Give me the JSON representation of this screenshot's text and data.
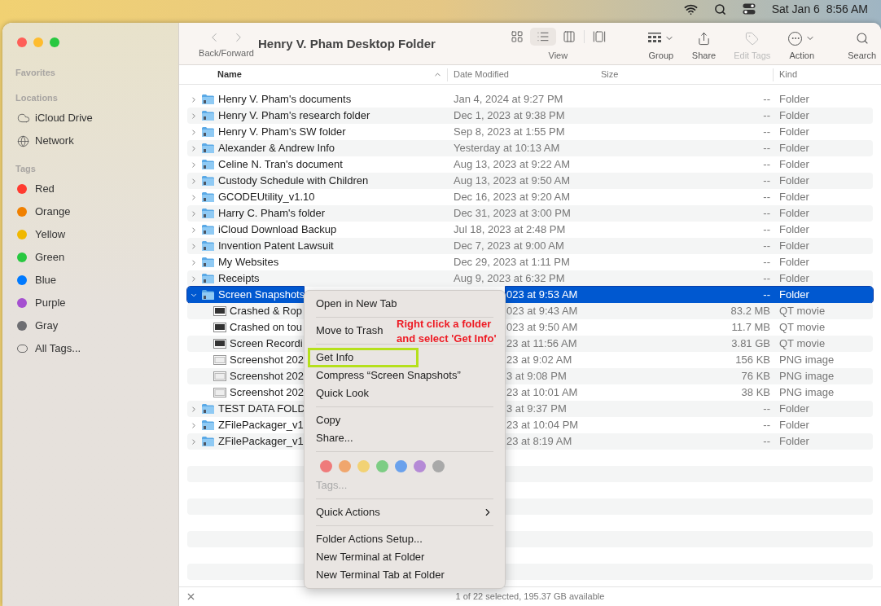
{
  "menu_bar": {
    "clock": "Sat Jan 6  8:56 AM"
  },
  "sidebar": {
    "sections": [
      {
        "title": "Favorites"
      },
      {
        "title": "Locations",
        "items": [
          {
            "label": "iCloud Drive",
            "kind": "cloud"
          },
          {
            "label": "Network",
            "kind": "network"
          }
        ]
      },
      {
        "title": "Tags",
        "items": [
          {
            "label": "Red",
            "kind": "tag",
            "color": "#ff3b30"
          },
          {
            "label": "Orange",
            "kind": "tag",
            "color": "#f08000"
          },
          {
            "label": "Yellow",
            "kind": "tag",
            "color": "#f0b800"
          },
          {
            "label": "Green",
            "kind": "tag",
            "color": "#28c840"
          },
          {
            "label": "Blue",
            "kind": "tag",
            "color": "#007aff"
          },
          {
            "label": "Purple",
            "kind": "tag",
            "color": "#a550d0"
          },
          {
            "label": "Gray",
            "kind": "tag",
            "color": "#6e6e72"
          },
          {
            "label": "All Tags...",
            "kind": "alltags"
          }
        ]
      }
    ]
  },
  "toolbar": {
    "nav_label": "Back/Forward",
    "title": "Henry V. Pham Desktop Folder",
    "view": {
      "label": "View",
      "modes": [
        {
          "kind": "icons",
          "selected": false
        },
        {
          "kind": "list",
          "selected": true
        },
        {
          "kind": "columns",
          "selected": false
        },
        {
          "kind": "gallery",
          "selected": false
        }
      ]
    },
    "buttons": [
      {
        "kind": "group",
        "label": "Group",
        "disabled": false
      },
      {
        "kind": "share",
        "label": "Share",
        "disabled": false
      },
      {
        "kind": "tags",
        "label": "Edit Tags",
        "disabled": true
      },
      {
        "kind": "action",
        "label": "Action",
        "disabled": false
      },
      {
        "kind": "search",
        "label": "Search",
        "disabled": false
      }
    ]
  },
  "table": {
    "columns": [
      "Name",
      "Date Modified",
      "Size",
      "Kind"
    ],
    "rows": [
      {
        "name": "Henry V. Pham's documents",
        "date": "Jan 4, 2024 at 9:27 PM",
        "size": "--",
        "file_kind": "Folder",
        "kind": "folder",
        "expanded": false,
        "selected": false
      },
      {
        "name": "Henry V. Pham's research folder",
        "date": "Dec 1, 2023 at 9:38 PM",
        "size": "--",
        "file_kind": "Folder",
        "kind": "folder",
        "expanded": false,
        "selected": false
      },
      {
        "name": "Henry V. Pham's SW folder",
        "date": "Sep 8, 2023 at 1:55 PM",
        "size": "--",
        "file_kind": "Folder",
        "kind": "folder",
        "expanded": false,
        "selected": false
      },
      {
        "name": "Alexander & Andrew Info",
        "date": "Yesterday at 10:13 AM",
        "size": "--",
        "file_kind": "Folder",
        "kind": "folder",
        "expanded": false,
        "selected": false
      },
      {
        "name": "Celine N. Tran's document",
        "date": "Aug 13, 2023 at 9:22 AM",
        "size": "--",
        "file_kind": "Folder",
        "kind": "folder",
        "expanded": false,
        "selected": false
      },
      {
        "name": "Custody Schedule with Children",
        "date": "Aug 13, 2023 at 9:50 AM",
        "size": "--",
        "file_kind": "Folder",
        "kind": "folder",
        "expanded": false,
        "selected": false
      },
      {
        "name": "GCODEUtility_v1.10",
        "date": "Dec 16, 2023 at 9:20 AM",
        "size": "--",
        "file_kind": "Folder",
        "kind": "folder",
        "expanded": false,
        "selected": false
      },
      {
        "name": "Harry C. Pham's folder",
        "date": "Dec 31, 2023 at 3:00 PM",
        "size": "--",
        "file_kind": "Folder",
        "kind": "folder",
        "expanded": false,
        "selected": false
      },
      {
        "name": "iCloud Download Backup",
        "date": "Jul 18, 2023 at 2:48 PM",
        "size": "--",
        "file_kind": "Folder",
        "kind": "folder",
        "expanded": false,
        "selected": false
      },
      {
        "name": "Invention Patent Lawsuit",
        "date": "Dec 7, 2023 at 9:00 AM",
        "size": "--",
        "file_kind": "Folder",
        "kind": "folder",
        "expanded": false,
        "selected": false
      },
      {
        "name": "My Websites",
        "date": "Dec 29, 2023 at 1:11 PM",
        "size": "--",
        "file_kind": "Folder",
        "kind": "folder",
        "expanded": false,
        "selected": false
      },
      {
        "name": "Receipts",
        "date": "Aug 9, 2023 at 6:32 PM",
        "size": "--",
        "file_kind": "Folder",
        "kind": "folder",
        "expanded": false,
        "selected": false
      },
      {
        "name": "Screen Snapshots",
        "date": "023 at 9:53 AM",
        "size": "--",
        "file_kind": "Folder",
        "kind": "folder",
        "expanded": true,
        "selected": true,
        "children": [
          {
            "name": "Crashed & Rop",
            "date": "023 at 9:43 AM",
            "size": "83.2 MB",
            "file_kind": "QT movie",
            "kind": "movie",
            "selected": false
          },
          {
            "name": "Crashed on tou",
            "date": "023 at 9:50 AM",
            "size": "11.7 MB",
            "file_kind": "QT movie",
            "kind": "movie",
            "selected": false
          },
          {
            "name": "Screen Recordi",
            "date": "23 at 11:56 AM",
            "size": "3.81 GB",
            "file_kind": "QT movie",
            "kind": "movie",
            "selected": false
          },
          {
            "name": "Screenshot 202",
            "date": "23 at 9:02 AM",
            "size": "156 KB",
            "file_kind": "PNG image",
            "kind": "image",
            "selected": false
          },
          {
            "name": "Screenshot 202",
            "date": "3 at 9:08 PM",
            "size": "76 KB",
            "file_kind": "PNG image",
            "kind": "image",
            "selected": false
          },
          {
            "name": "Screenshot 202",
            "date": "23 at 10:01 AM",
            "size": "38 KB",
            "file_kind": "PNG image",
            "kind": "image",
            "selected": false
          }
        ]
      },
      {
        "name": "TEST DATA FOLD",
        "date": "3 at 9:37 PM",
        "size": "--",
        "file_kind": "Folder",
        "kind": "folder",
        "expanded": false,
        "selected": false
      },
      {
        "name": "ZFilePackager_v1",
        "date": "23 at 10:04 PM",
        "size": "--",
        "file_kind": "Folder",
        "kind": "folder",
        "expanded": false,
        "selected": false
      },
      {
        "name": "ZFilePackager_v1",
        "date": "23 at 8:19 AM",
        "size": "--",
        "file_kind": "Folder",
        "kind": "folder",
        "expanded": false,
        "selected": false
      }
    ]
  },
  "context_menu": {
    "items": [
      {
        "kind": "item",
        "label": "Open in New Tab"
      },
      {
        "kind": "separator"
      },
      {
        "kind": "item",
        "label": "Move to Trash"
      },
      {
        "kind": "separator"
      },
      {
        "kind": "item",
        "label": "Get Info",
        "highlighted": true
      },
      {
        "kind": "item",
        "label": "Compress “Screen Snapshots”"
      },
      {
        "kind": "item",
        "label": "Quick Look"
      },
      {
        "kind": "separator"
      },
      {
        "kind": "item",
        "label": "Copy"
      },
      {
        "kind": "item",
        "label": "Share..."
      },
      {
        "kind": "separator"
      },
      {
        "kind": "colors",
        "colors": [
          {
            "color": "#ef7b7b"
          },
          {
            "color": "#f0a66d"
          },
          {
            "color": "#f2d274"
          },
          {
            "color": "#7dcd84"
          },
          {
            "color": "#6aa1ec"
          },
          {
            "color": "#b58ad6"
          },
          {
            "color": "#a9a9a9"
          }
        ]
      },
      {
        "kind": "disabled",
        "label": "Tags..."
      },
      {
        "kind": "separator"
      },
      {
        "kind": "submenu",
        "label": "Quick Actions"
      },
      {
        "kind": "separator"
      },
      {
        "kind": "item",
        "label": "Folder Actions Setup..."
      },
      {
        "kind": "item",
        "label": "New Terminal at Folder"
      },
      {
        "kind": "item",
        "label": "New Terminal Tab at Folder"
      }
    ]
  },
  "annotation": {
    "lines": [
      "Right click a folder",
      "and select 'Get Info'"
    ]
  },
  "status_bar": {
    "text": "1 of 22 selected, 195.37 GB available"
  }
}
